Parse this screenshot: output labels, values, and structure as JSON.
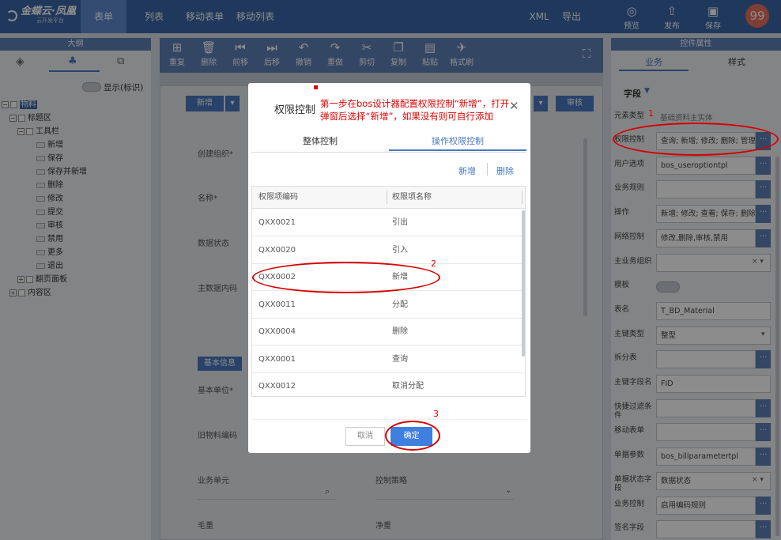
{
  "topbar": {
    "logo_text": "金蝶云·凤凰",
    "logo_sub": "云开发平台",
    "tabs": [
      {
        "label": "表单",
        "active": true
      },
      {
        "label": "列表",
        "active": false
      },
      {
        "label": "移动表单",
        "active": false
      },
      {
        "label": "移动列表",
        "active": false
      }
    ],
    "xml_label": "XML",
    "export_label": "导出",
    "preview_label": "预览",
    "publish_label": "发布",
    "save_label": "保存",
    "avatar_text": "99"
  },
  "outline": {
    "header": "大纲",
    "toggle_label": "显示(标识)",
    "tree": {
      "root": "物料",
      "title_area": "标题区",
      "toolbar": "工具栏",
      "toolbar_items": [
        "新增",
        "保存",
        "保存并新增",
        "删除",
        "修改",
        "提交",
        "审核",
        "禁用",
        "更多",
        "退出"
      ],
      "page_panel": "翻页面板",
      "content_area": "内容区"
    }
  },
  "designer": {
    "toolbar": [
      "重复",
      "删除",
      "前移",
      "后移",
      "撤销",
      "重做",
      "剪切",
      "复制",
      "粘贴",
      "格式刷"
    ],
    "buttons": {
      "add": "新增",
      "audit": "审核"
    },
    "fields": {
      "create_org": "创建组织*",
      "name": "名称*",
      "data_status": "数据状态",
      "master_code": "主数据内码",
      "basic_info_tab": "基本信息",
      "basic_unit": "基本单位*",
      "old_code": "旧物料编码",
      "business_unit": "业务单元",
      "control_policy": "控制策略",
      "gross_weight": "毛重",
      "net_weight": "净重"
    }
  },
  "properties": {
    "header": "控件属性",
    "tabs": [
      {
        "label": "业务",
        "active": true
      },
      {
        "label": "样式",
        "active": false
      }
    ],
    "section": "字段",
    "element_type_label": "元素类型",
    "element_type_value": "基础资料主实体",
    "rows": [
      {
        "label": "权限控制",
        "value": "查询; 新增; 修改; 删除; 管理I",
        "more": true
      },
      {
        "label": "用户选项",
        "value": "bos_useroptiontpl",
        "more": true
      },
      {
        "label": "业务规则",
        "value": "",
        "more": true
      },
      {
        "label": "操作",
        "value": "新增; 修改; 查看; 保存; 删除;",
        "more": true
      },
      {
        "label": "网络控制",
        "value": "修改,删除,审核,禁用",
        "more": true
      },
      {
        "label": "主业务组织",
        "value": "",
        "clear": "× ▾"
      },
      {
        "label": "模板",
        "value": "",
        "toggle": true
      },
      {
        "label": "表名",
        "value": "T_BD_Material"
      },
      {
        "label": "主键类型",
        "value": "整型",
        "dropdown": true
      },
      {
        "label": "拆分表",
        "value": "",
        "more": true
      },
      {
        "label": "主键字段名",
        "value": "FID"
      },
      {
        "label": "快捷过滤条件",
        "value": "",
        "more": true
      },
      {
        "label": "移动表单",
        "value": "",
        "more": true
      },
      {
        "label": "单据参数",
        "value": "bos_billparametertpl",
        "more": true
      },
      {
        "label": "单据状态字段",
        "value": "数据状态",
        "clear": "× ▾"
      },
      {
        "label": "业务控制",
        "value": "启用编码规则",
        "more": true
      },
      {
        "label": "签名字段",
        "value": "",
        "more": true
      }
    ]
  },
  "dialog": {
    "title": "权限控制",
    "tabs": [
      {
        "label": "整体控制",
        "active": false
      },
      {
        "label": "操作权限控制",
        "active": true
      }
    ],
    "add_label": "新增",
    "delete_label": "删除",
    "columns": [
      "权限项编码",
      "权限项名称"
    ],
    "rows": [
      {
        "code": "QXX0021",
        "name": "引出"
      },
      {
        "code": "QXX0020",
        "name": "引入"
      },
      {
        "code": "QXX0002",
        "name": "新增"
      },
      {
        "code": "QXX0011",
        "name": "分配"
      },
      {
        "code": "QXX0004",
        "name": "删除"
      },
      {
        "code": "QXX0001",
        "name": "查询"
      },
      {
        "code": "QXX0012",
        "name": "取消分配"
      }
    ],
    "cancel_label": "取消",
    "ok_label": "确定"
  },
  "annotations": {
    "note_line1": "第一步在bos设计器配置权限控制“新增”，打开",
    "note_line2": "弹窗后选择“新增”，如果没有则可自行添加",
    "marker1": "1",
    "marker2": "2",
    "marker3": "3",
    "color": "#e00000"
  }
}
